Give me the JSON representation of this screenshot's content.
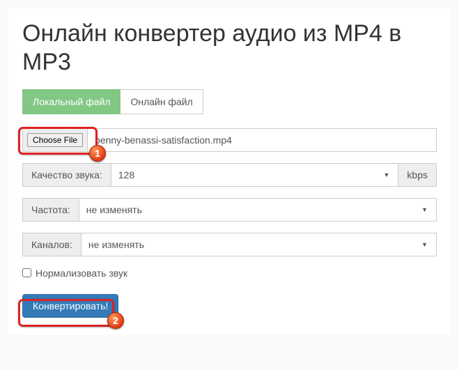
{
  "title": "Онлайн конвертер аудио из MP4 в MP3",
  "tabs": {
    "local": "Локальный файл",
    "online": "Онлайн файл"
  },
  "file": {
    "choose_label": "Choose File",
    "filename": "benny-benassi-satisfaction.mp4"
  },
  "quality": {
    "label": "Качество звука:",
    "value": "128",
    "unit": "kbps"
  },
  "frequency": {
    "label": "Частота:",
    "value": "не изменять"
  },
  "channels": {
    "label": "Каналов:",
    "value": "не изменять"
  },
  "normalize": {
    "label": "Нормализовать звук"
  },
  "convert": {
    "label": "Конвертировать!"
  },
  "annotations": {
    "badge1": "1",
    "badge2": "2"
  }
}
